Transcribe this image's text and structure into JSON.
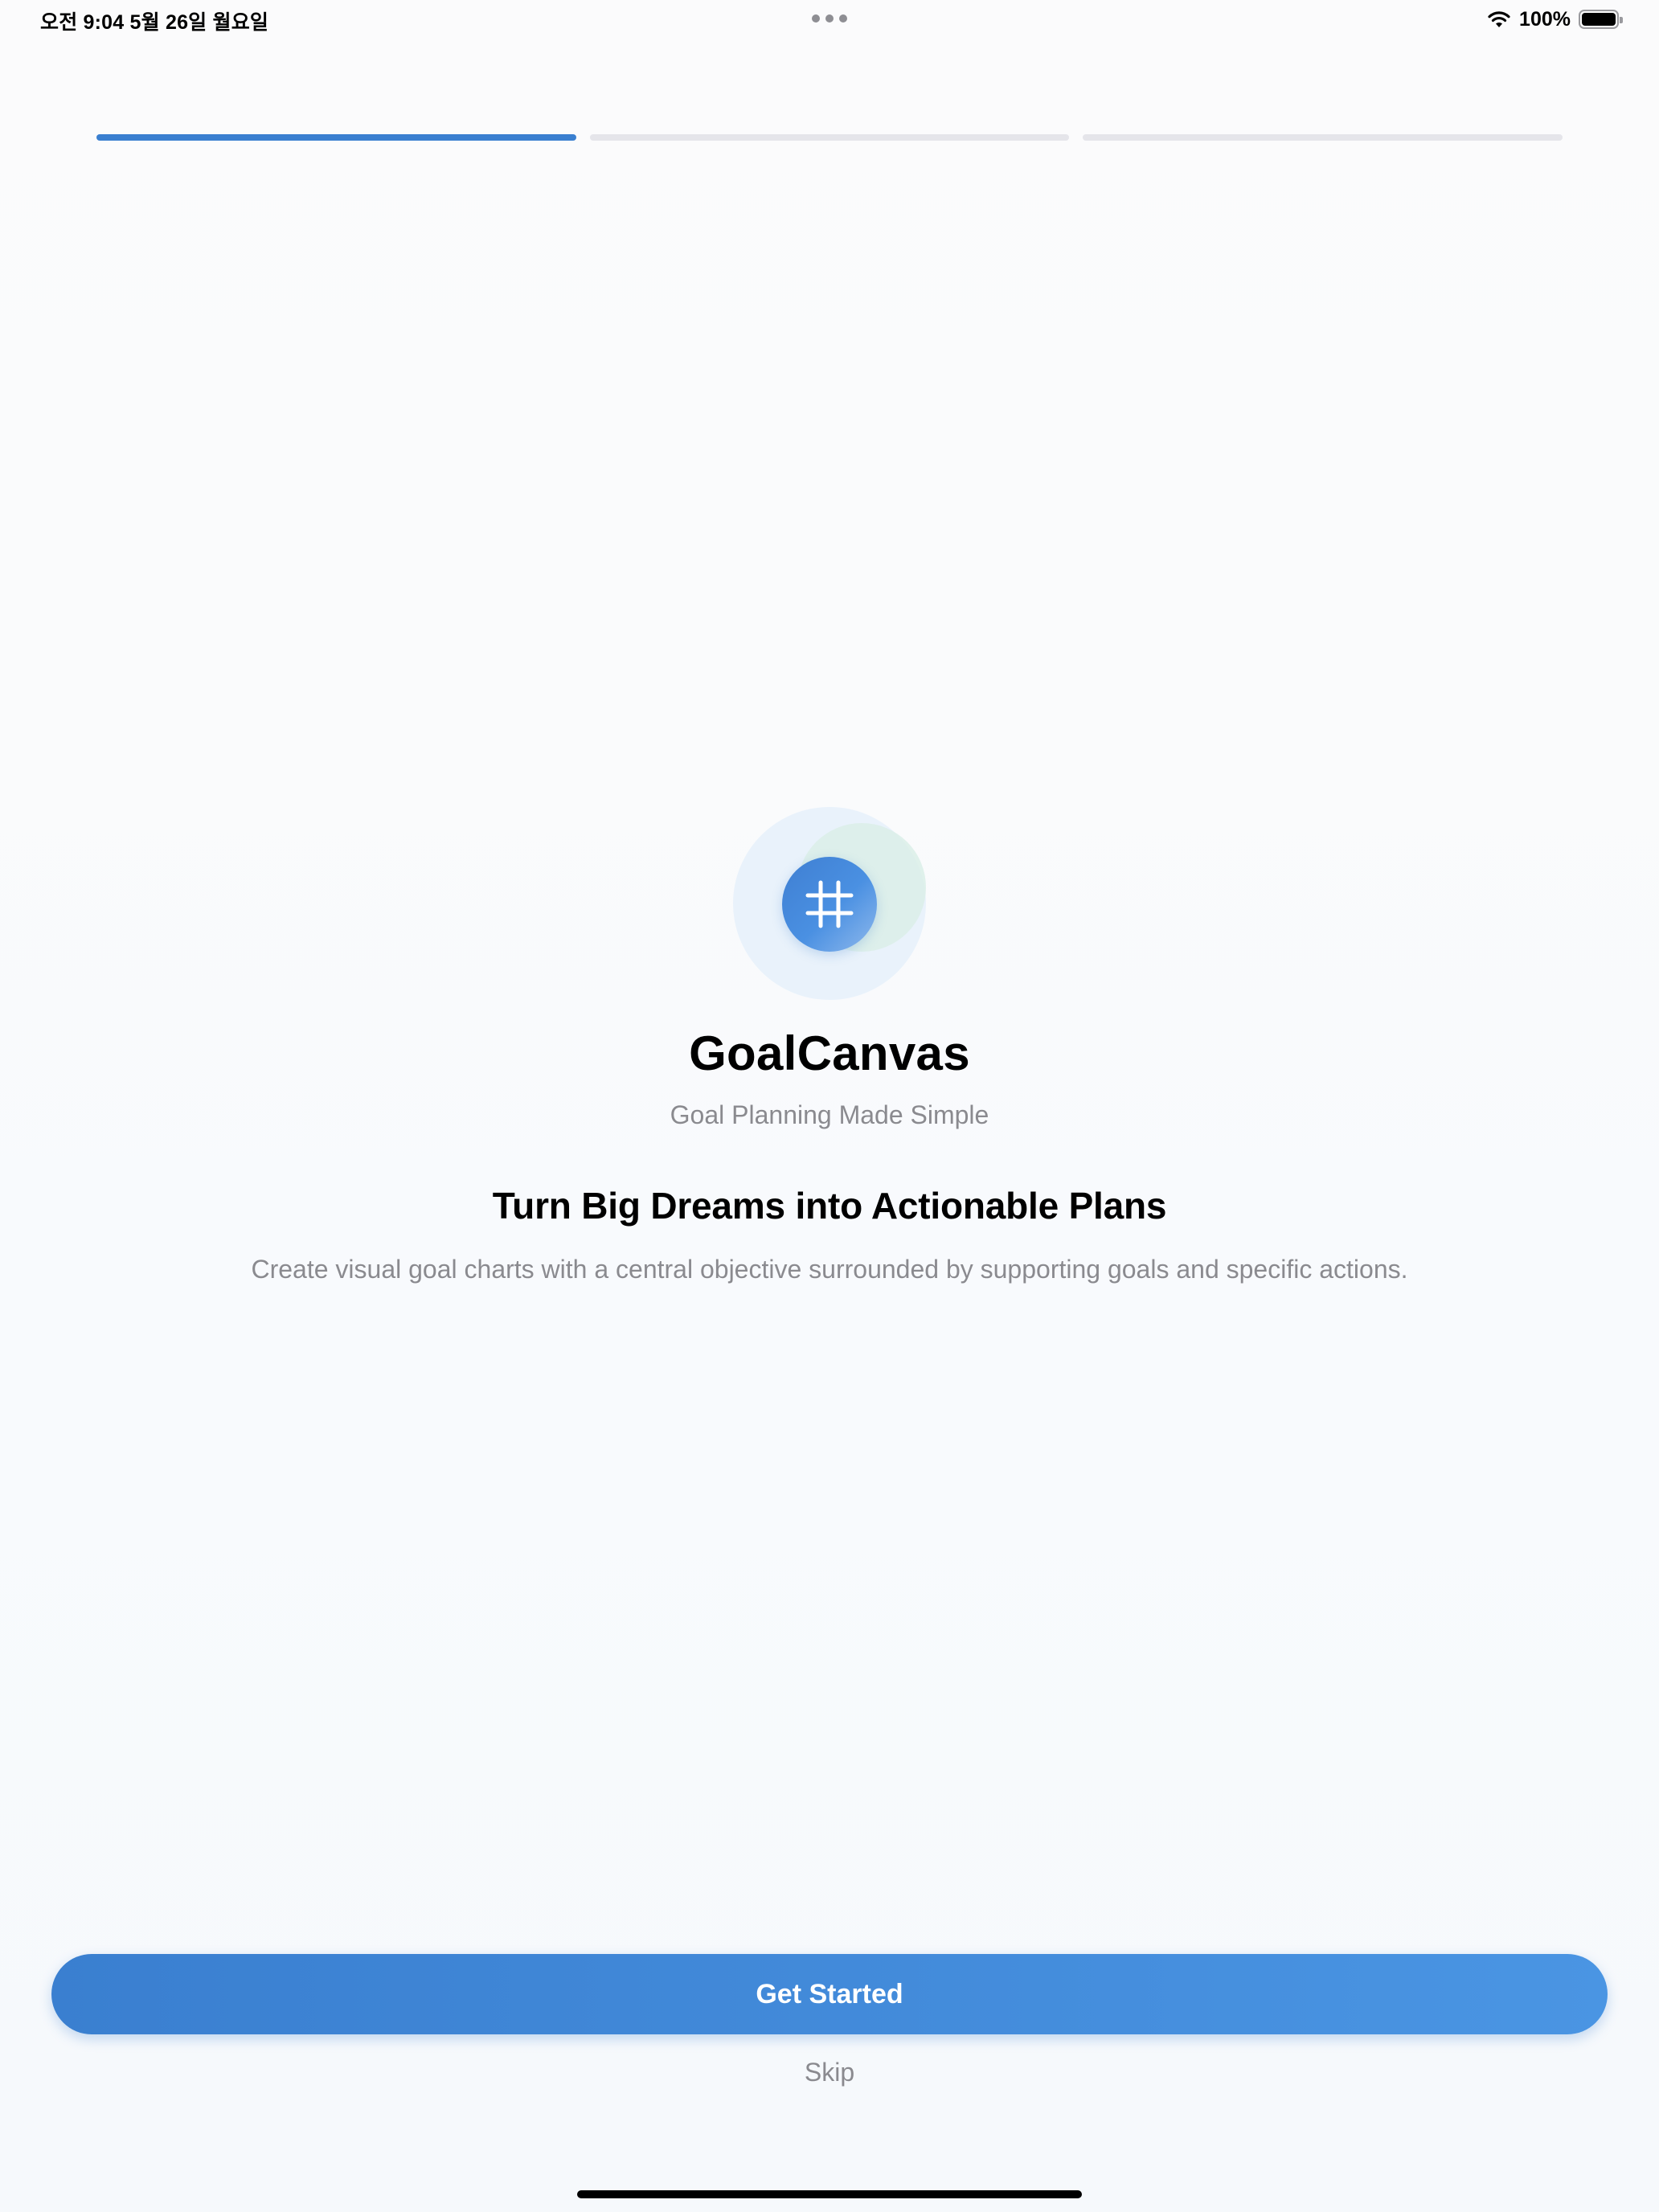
{
  "status_bar": {
    "time": "오전 9:04   5월 26일 월요일",
    "battery_percent": "100%",
    "battery_level": 1.0
  },
  "onboarding": {
    "total_steps": 3,
    "current_step": 1
  },
  "app": {
    "name": "GoalCanvas",
    "tagline": "Goal Planning Made Simple",
    "logo_icon": "grid-icon"
  },
  "content": {
    "headline": "Turn Big Dreams into Actionable Plans",
    "description": "Create visual goal charts with a central objective surrounded by supporting goals and specific actions."
  },
  "actions": {
    "primary_label": "Get Started",
    "secondary_label": "Skip"
  },
  "colors": {
    "accent": "#3a7fd0",
    "accent_light": "#4a95e3",
    "inactive_segment": "#e5e5ea",
    "secondary_text": "#8a8a8f"
  }
}
